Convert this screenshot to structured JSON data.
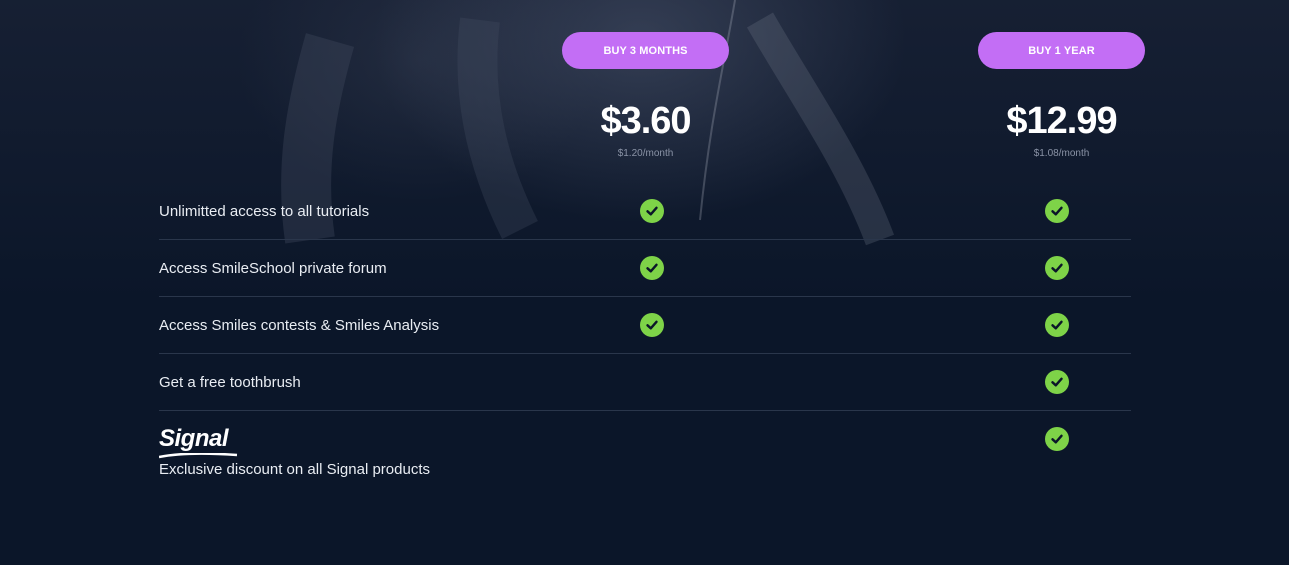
{
  "plans": [
    {
      "button_label": "BUY 3 MONTHS",
      "price": "$3.60",
      "per_month": "$1.20/month"
    },
    {
      "button_label": "BUY 1 YEAR",
      "price": "$12.99",
      "per_month": "$1.08/month"
    }
  ],
  "features": [
    {
      "label": "Unlimitted access to all tutorials",
      "plan_3_months": true,
      "plan_1_year": true
    },
    {
      "label": "Access SmileSchool private forum",
      "plan_3_months": true,
      "plan_1_year": true
    },
    {
      "label": "Access Smiles contests & Smiles Analysis",
      "plan_3_months": true,
      "plan_1_year": true
    },
    {
      "label": "Get a free toothbrush",
      "plan_3_months": false,
      "plan_1_year": true
    },
    {
      "label": "Exclusive discount on all Signal products",
      "logo_text": "Signal",
      "plan_3_months": false,
      "plan_1_year": true
    }
  ],
  "colors": {
    "background": "#0b1629",
    "button": "#c36ef5",
    "check": "#7ed348",
    "divider": "#2a364b"
  },
  "icons": {
    "check": "check-circle-icon"
  }
}
